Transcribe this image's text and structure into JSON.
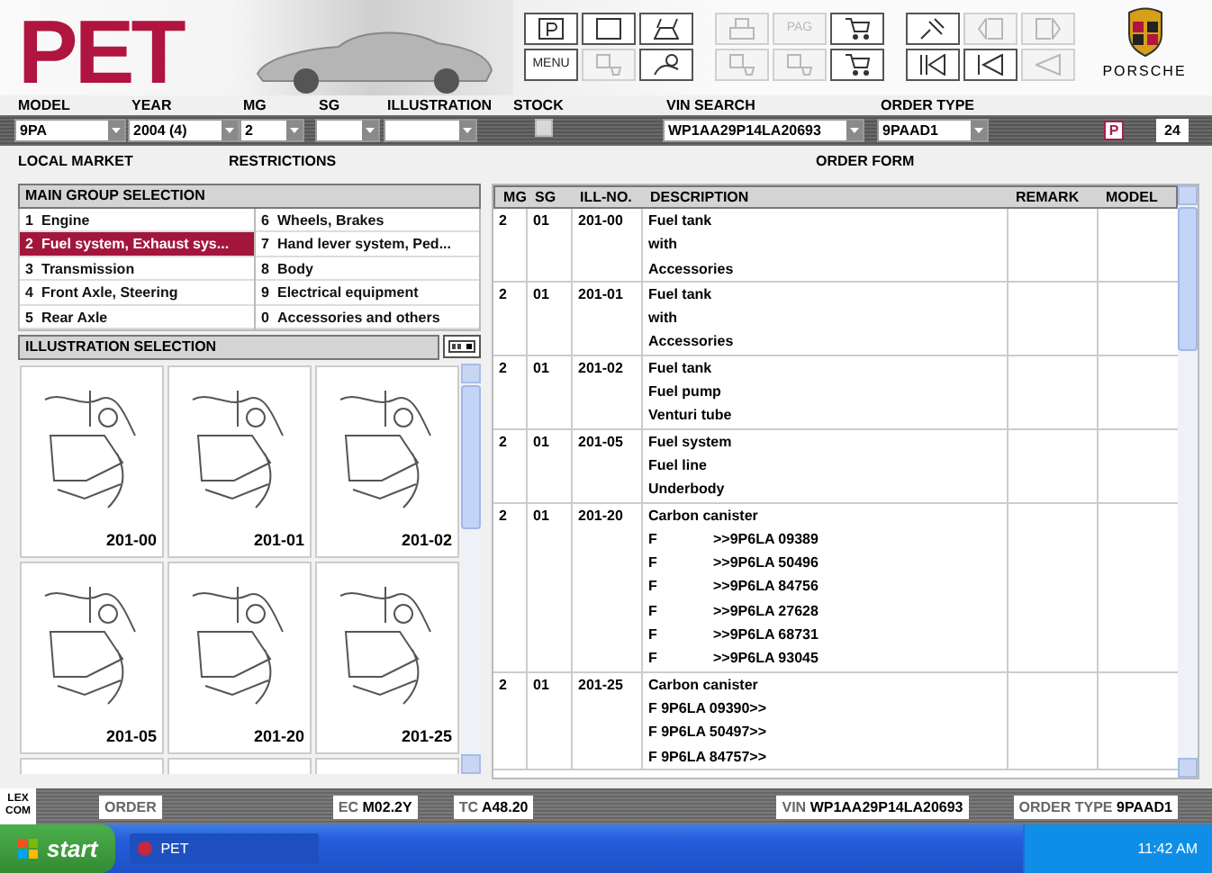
{
  "header": {
    "logo": "PET",
    "brand": "PORSCHE",
    "toolbar": [
      {
        "kind": "icon",
        "disabled": false
      },
      {
        "kind": "icon",
        "disabled": false
      },
      {
        "kind": "icon",
        "disabled": false
      },
      {
        "kind": "text",
        "label": "MENU",
        "disabled": false
      },
      {
        "kind": "icon",
        "disabled": true
      },
      {
        "kind": "icon",
        "disabled": false
      },
      {
        "kind": "icon",
        "disabled": true
      },
      {
        "kind": "text",
        "label": "PAG",
        "disabled": true
      },
      {
        "kind": "icon",
        "disabled": false
      },
      {
        "kind": "icon",
        "disabled": true
      },
      {
        "kind": "icon",
        "disabled": true
      },
      {
        "kind": "icon",
        "disabled": false
      },
      {
        "kind": "icon",
        "disabled": false
      },
      {
        "kind": "icon",
        "disabled": true
      },
      {
        "kind": "icon",
        "disabled": true
      },
      {
        "kind": "icon",
        "disabled": false
      },
      {
        "kind": "icon",
        "disabled": false
      },
      {
        "kind": "icon",
        "disabled": true
      }
    ]
  },
  "filters": [
    {
      "kind": "select",
      "label": "MODEL",
      "value": "9PA"
    },
    {
      "kind": "select",
      "label": "YEAR",
      "value": "2004 (4)"
    },
    {
      "kind": "select",
      "label": "MG",
      "value": "2"
    },
    {
      "kind": "select",
      "label": "SG"
    },
    {
      "kind": "select",
      "label": "ILLUSTRATION"
    },
    {
      "kind": "checkbox",
      "label": "STOCK",
      "checked": false
    },
    {
      "kind": "select",
      "label": "VIN SEARCH",
      "value": "WP1AA29P14LA20693"
    },
    {
      "kind": "select",
      "label": "ORDER TYPE",
      "value": "9PAAD1"
    }
  ],
  "badge": "P",
  "count": "24",
  "sublabels": [
    "LOCAL MARKET",
    "RESTRICTIONS",
    "ORDER FORM"
  ],
  "main_groups": {
    "title": "MAIN GROUP SELECTION",
    "items": [
      {
        "number": "1",
        "label": "Engine",
        "selected": false
      },
      {
        "number": "2",
        "label": "Fuel system, Exhaust sys...",
        "selected": true
      },
      {
        "number": "3",
        "label": "Transmission",
        "selected": false
      },
      {
        "number": "4",
        "label": "Front Axle, Steering",
        "selected": false
      },
      {
        "number": "5",
        "label": "Rear Axle",
        "selected": false
      },
      {
        "number": "6",
        "label": "Wheels, Brakes",
        "selected": false
      },
      {
        "number": "7",
        "label": "Hand lever system, Ped...",
        "selected": false
      },
      {
        "number": "8",
        "label": "Body",
        "selected": false
      },
      {
        "number": "9",
        "label": "Electrical equipment",
        "selected": false
      },
      {
        "number": "0",
        "label": "Accessories and others",
        "selected": false
      }
    ]
  },
  "illustrations": {
    "title": "ILLUSTRATION SELECTION",
    "items": [
      {
        "label": "201-00"
      },
      {
        "label": "201-01"
      },
      {
        "label": "201-02"
      },
      {
        "label": "201-05"
      },
      {
        "label": "201-20"
      },
      {
        "label": "201-25"
      }
    ]
  },
  "table": {
    "columns": [
      "MG",
      "SG",
      "ILL-NO.",
      "DESCRIPTION",
      "REMARK",
      "MODEL"
    ],
    "rows": [
      {
        "mg": "2",
        "sg": "01",
        "ill_no": "201-00",
        "lines": [
          {
            "text": "Fuel tank"
          },
          {
            "text": "with"
          },
          {
            "text": "Accessories"
          }
        ]
      },
      {
        "mg": "2",
        "sg": "01",
        "ill_no": "201-01",
        "lines": [
          {
            "text": "Fuel tank"
          },
          {
            "text": "with"
          },
          {
            "text": "Accessories"
          }
        ]
      },
      {
        "mg": "2",
        "sg": "01",
        "ill_no": "201-02",
        "lines": [
          {
            "text": "Fuel tank"
          },
          {
            "text": "Fuel pump"
          },
          {
            "text": "Venturi tube"
          }
        ]
      },
      {
        "mg": "2",
        "sg": "01",
        "ill_no": "201-05",
        "lines": [
          {
            "text": "Fuel system"
          },
          {
            "text": "Fuel line"
          },
          {
            "text": "Underbody"
          }
        ]
      },
      {
        "mg": "2",
        "sg": "01",
        "ill_no": "201-20",
        "lines": [
          {
            "text": "Carbon canister"
          },
          {
            "text": "F",
            "code": ">>9P6LA 09389"
          },
          {
            "text": "F",
            "code": ">>9P6LA 50496"
          },
          {
            "text": "F",
            "code": ">>9P6LA 84756"
          },
          {
            "text": "F",
            "code": ">>9P6LA 27628"
          },
          {
            "text": "F",
            "code": ">>9P6LA 68731"
          },
          {
            "text": "F",
            "code": ">>9P6LA 93045"
          }
        ]
      },
      {
        "mg": "2",
        "sg": "01",
        "ill_no": "201-25",
        "lines": [
          {
            "text": "Carbon canister"
          },
          {
            "text": "F 9P6LA 09390>>"
          },
          {
            "text": "F 9P6LA 50497>>"
          },
          {
            "text": "F 9P6LA 84757>>"
          }
        ]
      }
    ]
  },
  "status_bar": {
    "logo": [
      "LEX",
      "COM"
    ],
    "fields": [
      {
        "label": "ORDER"
      },
      {
        "label": "EC",
        "value": "M02.2Y"
      },
      {
        "label": "TC",
        "value": "A48.20"
      },
      {
        "label": "VIN",
        "value": "WP1AA29P14LA20693"
      },
      {
        "label": "ORDER TYPE",
        "value": "9PAAD1"
      }
    ]
  },
  "taskbar": {
    "start": "start",
    "tasks": [
      "PET"
    ],
    "clock": "11:42 AM"
  }
}
